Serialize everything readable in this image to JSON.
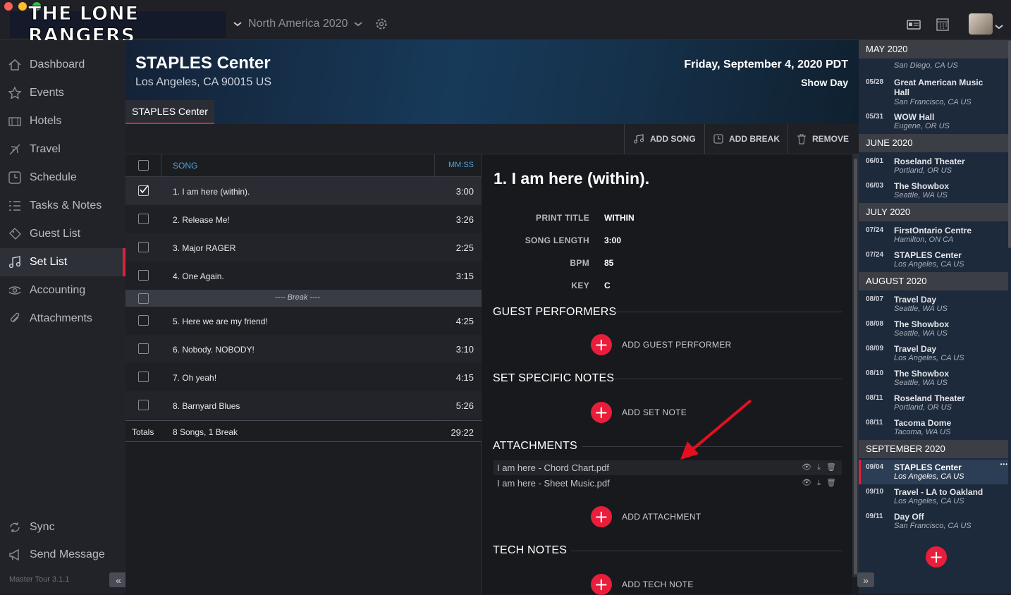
{
  "app": {
    "band_name": "THE LONE RANGERS",
    "tour_name": "North America 2020",
    "version": "Master Tour 3.1.1"
  },
  "sidebar": {
    "items": [
      {
        "label": "Dashboard",
        "icon": "home-icon"
      },
      {
        "label": "Events",
        "icon": "star-icon"
      },
      {
        "label": "Hotels",
        "icon": "hotel-icon"
      },
      {
        "label": "Travel",
        "icon": "plane-icon"
      },
      {
        "label": "Schedule",
        "icon": "clock-icon"
      },
      {
        "label": "Tasks & Notes",
        "icon": "list-icon"
      },
      {
        "label": "Guest List",
        "icon": "ticket-icon"
      },
      {
        "label": "Set List",
        "icon": "music-note-icon",
        "active": true
      },
      {
        "label": "Accounting",
        "icon": "money-icon"
      },
      {
        "label": "Attachments",
        "icon": "paperclip-icon"
      }
    ],
    "bottom": [
      {
        "label": "Sync",
        "icon": "sync-icon"
      },
      {
        "label": "Send Message",
        "icon": "megaphone-icon"
      }
    ]
  },
  "event": {
    "venue": "STAPLES Center",
    "address": "Los Angeles, CA 90015 US",
    "date": "Friday, September 4, 2020 PDT",
    "day_type": "Show Day",
    "tab": "STAPLES Center"
  },
  "toolbar": {
    "add_song": "ADD SONG",
    "add_break": "ADD BREAK",
    "remove": "REMOVE"
  },
  "setlist": {
    "col_song": "SONG",
    "col_time": "MM:SS",
    "rows": [
      {
        "name": "1. I am here (within).",
        "time": "3:00",
        "checked": true,
        "selected": true
      },
      {
        "name": "2. Release Me!",
        "time": "3:26"
      },
      {
        "name": "3. Major RAGER",
        "time": "2:25"
      },
      {
        "name": "4. One Again.",
        "time": "3:15"
      },
      {
        "name": "---- Break ----",
        "time": "",
        "break": true
      },
      {
        "name": "5. Here we are my friend!",
        "time": "4:25"
      },
      {
        "name": "6. Nobody. NOBODY!",
        "time": "3:10"
      },
      {
        "name": "7. Oh yeah!",
        "time": "4:15"
      },
      {
        "name": "8. Barnyard Blues",
        "time": "5:26"
      }
    ],
    "totals_label": "Totals",
    "totals_desc": "8 Songs, 1 Break",
    "totals_time": "29:22"
  },
  "detail": {
    "heading": "1. I am here (within).",
    "fields": [
      {
        "key": "PRINT TITLE",
        "value": "WITHIN"
      },
      {
        "key": "SONG LENGTH",
        "value": "3:00"
      },
      {
        "key": "BPM",
        "value": "85"
      },
      {
        "key": "KEY",
        "value": "C"
      }
    ],
    "guest_header": "GUEST PERFORMERS",
    "add_guest": "ADD GUEST PERFORMER",
    "notes_header": "SET SPECIFIC NOTES",
    "add_note": "ADD SET NOTE",
    "attachments_header": "ATTACHMENTS",
    "attachments": [
      "I am here - Chord Chart.pdf",
      "I am here - Sheet Music.pdf"
    ],
    "add_attachment": "ADD ATTACHMENT",
    "tech_header": "TECH NOTES",
    "add_tech": "ADD TECH NOTE"
  },
  "calendar": {
    "months": [
      {
        "name": "MAY 2020",
        "items": [
          {
            "date": "",
            "name": "",
            "loc": "San Diego, CA US"
          },
          {
            "date": "05/28",
            "name": "Great American Music Hall",
            "loc": "San Francisco, CA US"
          },
          {
            "date": "05/31",
            "name": "WOW Hall",
            "loc": "Eugene, OR US"
          }
        ]
      },
      {
        "name": "JUNE 2020",
        "items": [
          {
            "date": "06/01",
            "name": "Roseland Theater",
            "loc": "Portland, OR US"
          },
          {
            "date": "06/03",
            "name": "The Showbox",
            "loc": "Seattle, WA US"
          }
        ]
      },
      {
        "name": "JULY 2020",
        "items": [
          {
            "date": "07/24",
            "name": "FirstOntario Centre",
            "loc": "Hamilton, ON CA"
          },
          {
            "date": "07/24",
            "name": "STAPLES Center",
            "loc": "Los Angeles, CA US"
          }
        ]
      },
      {
        "name": "AUGUST 2020",
        "items": [
          {
            "date": "08/07",
            "name": "Travel Day",
            "loc": "Seattle, WA US"
          },
          {
            "date": "08/08",
            "name": "The Showbox",
            "loc": "Seattle, WA US"
          },
          {
            "date": "08/09",
            "name": "Travel Day",
            "loc": "Los Angeles, CA US"
          },
          {
            "date": "08/10",
            "name": "The Showbox",
            "loc": "Seattle, WA US"
          },
          {
            "date": "08/11",
            "name": "Roseland Theater",
            "loc": "Portland, OR US"
          },
          {
            "date": "08/11",
            "name": "Tacoma Dome",
            "loc": "Tacoma, WA US"
          }
        ]
      },
      {
        "name": "SEPTEMBER 2020",
        "items": [
          {
            "date": "09/04",
            "name": "STAPLES Center",
            "loc": "Los Angeles, CA US",
            "selected": true
          },
          {
            "date": "09/10",
            "name": "Travel - LA to Oakland",
            "loc": "Los Angeles, CA US"
          },
          {
            "date": "09/11",
            "name": "Day Off",
            "loc": "San Francisco, CA US"
          }
        ]
      }
    ]
  },
  "colors": {
    "accent": "#ea1d3b",
    "sidebar_bg": "#222329",
    "calendar_bg": "#1d2a3c"
  }
}
